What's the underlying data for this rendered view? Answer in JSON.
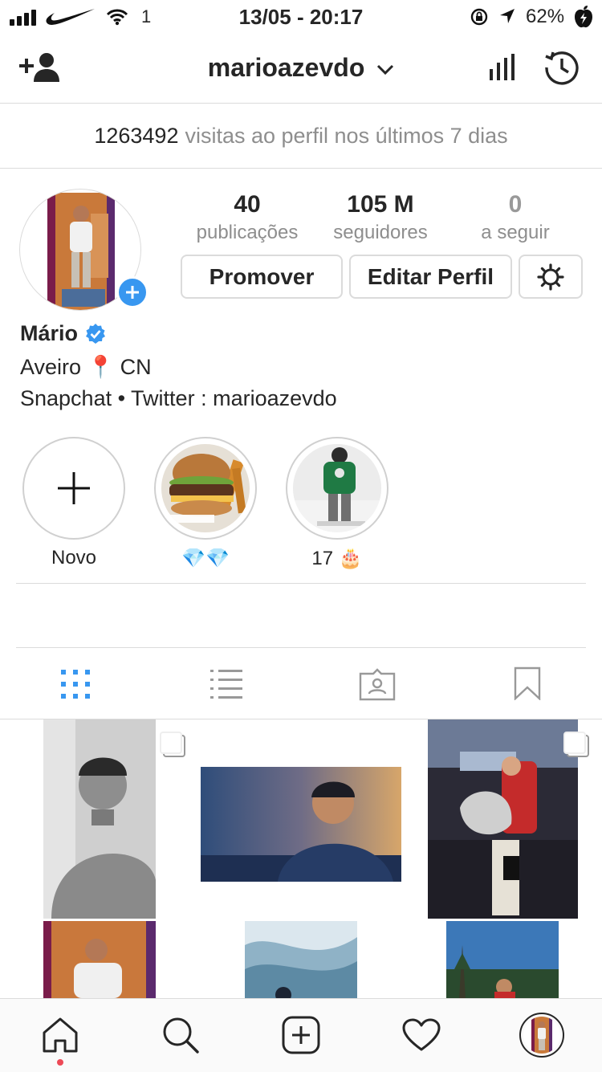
{
  "status_bar": {
    "carrier_indicator": "1",
    "time": "13/05 - 20:17",
    "battery": "62%"
  },
  "header": {
    "username": "marioazevdo",
    "icons": [
      "add-user-icon",
      "chevron-down-icon",
      "insights-icon",
      "archive-icon"
    ]
  },
  "visits": {
    "count": "1263492",
    "text": "visitas ao perfil nos últimos 7 dias"
  },
  "profile": {
    "stats": [
      {
        "value": "40",
        "label": "publicações"
      },
      {
        "value": "105 M",
        "label": "seguidores"
      },
      {
        "value": "0",
        "label": "a seguir"
      }
    ],
    "buttons": {
      "promote": "Promover",
      "edit": "Editar Perfil"
    },
    "name": "Mário",
    "bio_line1": "Aveiro 📍 CN",
    "bio_line2": "Snapchat • Twitter : marioazevdo"
  },
  "highlights": [
    {
      "label": "Novo"
    },
    {
      "label": "💎💎"
    },
    {
      "label": "17 🎂"
    }
  ],
  "tabs": [
    "grid-icon",
    "list-icon",
    "tagged-icon",
    "saved-icon"
  ],
  "nav": [
    "home-icon",
    "search-icon",
    "add-post-icon",
    "heart-icon",
    "profile-avatar"
  ],
  "colors": {
    "accent": "#3897f0",
    "border": "#dbdbdb",
    "muted": "#8e8e8e",
    "notification": "#ed4956"
  }
}
